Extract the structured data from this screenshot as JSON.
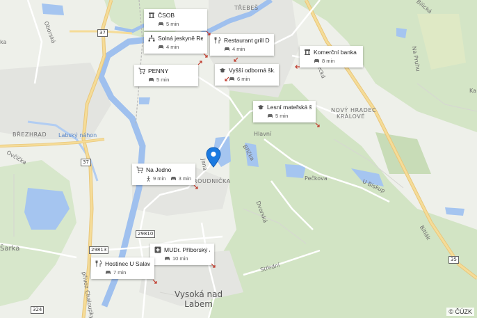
{
  "map": {
    "copyright": "© ČÚZK",
    "marker_icon": "location-pin-icon",
    "colors": {
      "water": "#a5c5f0",
      "forest": "#cfe2c1",
      "road_major": "#f3d98e",
      "background": "#eef0ea",
      "pin": "#1a7ae0"
    }
  },
  "labels": {
    "trebes": "TŘEBEŠ",
    "brezhrad": "BŘEZHRAD",
    "labsky_nahon": "Labský náhon",
    "novy_hradec_1": "NOVÝ HRADEC",
    "novy_hradec_2": "KRÁLOVÉ",
    "roudnicka": "ROUDNIČKA",
    "vysoka_1": "Vysoká nad",
    "vysoka_2": "Labem",
    "hlavni": "Hlavní",
    "peckova": "Pečkova",
    "u_biskupe": "U Biskup",
    "ka": "Ka",
    "ka_left": "ka",
    "stredeka": "Střední",
    "bricka": "Bříčka",
    "dvorska": "Dvorská",
    "na_pruhu": "Na Pruhu",
    "bitlak": "Bitlák",
    "hradecka": "Hradecká",
    "oborska": "Oborská",
    "ovcicka": "Ovčička",
    "prdkova": "přívoz Chaloupky",
    "sarka": "Šarka",
    "jana": "Jana",
    "bilicka": "Bilická"
  },
  "shields": {
    "r37a": "37",
    "r37b": "37",
    "r35": "35",
    "r29810": "29810",
    "r29813": "29813",
    "r324": "324"
  },
  "pois": [
    {
      "name": "ČSOB",
      "icon": "bank-icon",
      "mode_icon": "car-icon",
      "time": "5 min"
    },
    {
      "name": "Solná jeskyně Rel...",
      "icon": "sitemap-icon",
      "mode_icon": "car-icon",
      "time": "4 min"
    },
    {
      "name": "Restaurant grill D...",
      "icon": "fork-knife-icon",
      "mode_icon": "car-icon",
      "time": "4 min"
    },
    {
      "name": "Komerční banka",
      "icon": "bank-icon",
      "mode_icon": "car-icon",
      "time": "8 min"
    },
    {
      "name": "PENNY",
      "icon": "shopping-cart-icon",
      "mode_icon": "car-icon",
      "time": "5 min"
    },
    {
      "name": "Vyšší odborná šk...",
      "icon": "graduation-cap-icon",
      "mode_icon": "car-icon",
      "time": "6 min"
    },
    {
      "name": "Lesní mateřská š...",
      "icon": "graduation-cap-icon",
      "mode_icon": "car-icon",
      "time": "5 min"
    },
    {
      "name": "Na Jedno",
      "icon": "shopping-cart-icon",
      "walk_icon": "walking-person-icon",
      "walk_time": "9 min",
      "mode_icon": "car-icon",
      "time": "3 min"
    },
    {
      "name": "MUDr. Příborský Jiří",
      "icon": "medical-cross-icon",
      "mode_icon": "car-icon",
      "time": "10 min"
    },
    {
      "name": "Hostinec U Salavcu",
      "icon": "fork-knife-icon",
      "mode_icon": "car-icon",
      "time": "7 min"
    }
  ]
}
